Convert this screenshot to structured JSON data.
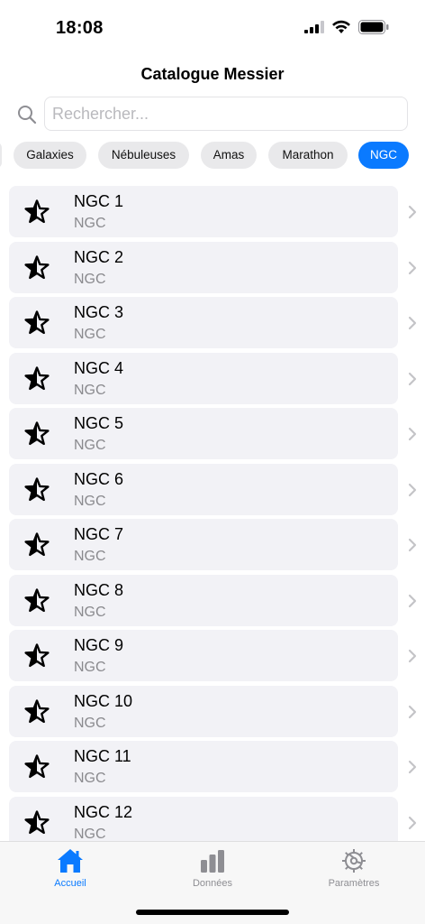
{
  "status_bar": {
    "time": "18:08"
  },
  "nav": {
    "title": "Catalogue Messier"
  },
  "search": {
    "placeholder": "Rechercher..."
  },
  "filters": {
    "chips": [
      {
        "label": "Galaxies",
        "selected": false
      },
      {
        "label": "Nébuleuses",
        "selected": false
      },
      {
        "label": "Amas",
        "selected": false
      },
      {
        "label": "Marathon",
        "selected": false
      },
      {
        "label": "NGC",
        "selected": true
      }
    ]
  },
  "list": {
    "items": [
      {
        "title": "NGC 1",
        "subtitle": "NGC"
      },
      {
        "title": "NGC 2",
        "subtitle": "NGC"
      },
      {
        "title": "NGC 3",
        "subtitle": "NGC"
      },
      {
        "title": "NGC 4",
        "subtitle": "NGC"
      },
      {
        "title": "NGC 5",
        "subtitle": "NGC"
      },
      {
        "title": "NGC 6",
        "subtitle": "NGC"
      },
      {
        "title": "NGC 7",
        "subtitle": "NGC"
      },
      {
        "title": "NGC 8",
        "subtitle": "NGC"
      },
      {
        "title": "NGC 9",
        "subtitle": "NGC"
      },
      {
        "title": "NGC 10",
        "subtitle": "NGC"
      },
      {
        "title": "NGC 11",
        "subtitle": "NGC"
      },
      {
        "title": "NGC 12",
        "subtitle": "NGC"
      }
    ],
    "item_icon": "half-star-icon"
  },
  "tabbar": {
    "tabs": [
      {
        "label": "Accueil",
        "icon": "house-icon",
        "selected": true
      },
      {
        "label": "Données",
        "icon": "bar-chart-icon",
        "selected": false
      },
      {
        "label": "Paramètres",
        "icon": "gear-icon",
        "selected": false
      }
    ]
  },
  "colors": {
    "accent": "#0a7aff",
    "row_background": "#f2f2f6",
    "chip_background": "#e9e9eb",
    "secondary_text": "#8a8a8e",
    "inactive_tab": "#8e8e93"
  }
}
